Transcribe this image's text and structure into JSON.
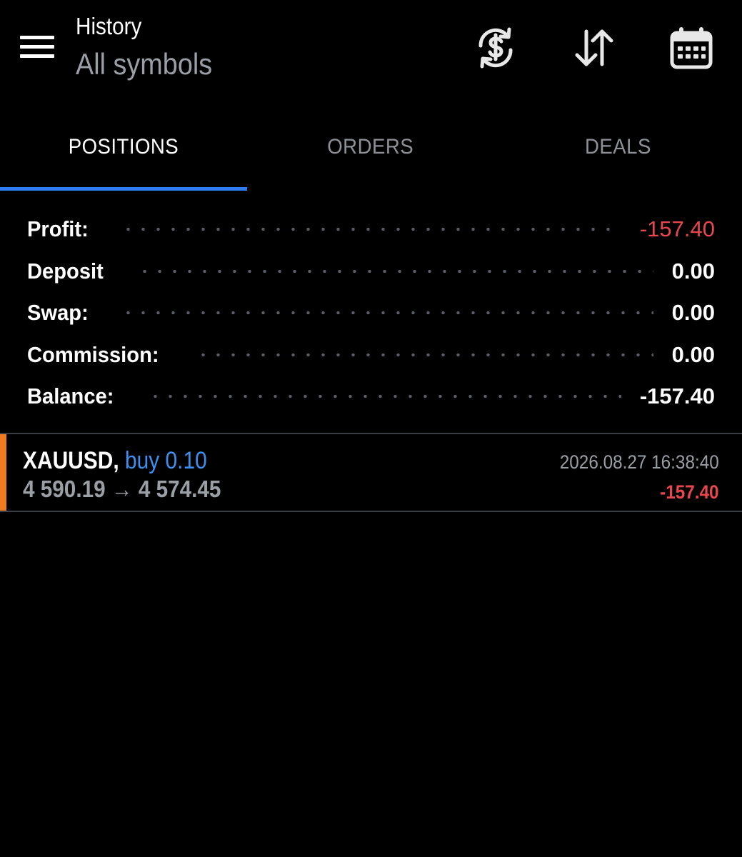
{
  "header": {
    "title": "History",
    "subtitle": "All symbols",
    "icons": [
      "menu-icon",
      "currency-exchange-icon",
      "sort-icon",
      "calendar-icon"
    ]
  },
  "tabs": [
    {
      "label": "POSITIONS",
      "active": true
    },
    {
      "label": "ORDERS",
      "active": false
    },
    {
      "label": "DEALS",
      "active": false
    }
  ],
  "summary": {
    "profit": {
      "label": "Profit:",
      "value": "-157.40"
    },
    "deposit": {
      "label": "Deposit",
      "value": "0.00"
    },
    "swap": {
      "label": "Swap:",
      "value": "0.00"
    },
    "commission": {
      "label": "Commission:",
      "value": "0.00"
    },
    "balance": {
      "label": "Balance:",
      "value": "-157.40"
    }
  },
  "positions": [
    {
      "symbol": "XAUUSD,",
      "type": "buy 0.10",
      "open_price": "4 590.19",
      "arrow": "→",
      "close_price": "4 574.45",
      "time": "2026.08.27 16:38:40",
      "profit": "-157.40"
    }
  ],
  "colors": {
    "background": "#000000",
    "accent": "#2f7bf0",
    "buy": "#3d8ff0",
    "loss": "#e8474e",
    "muted": "#9a9fa6",
    "position_bar": "#f07a1f"
  }
}
